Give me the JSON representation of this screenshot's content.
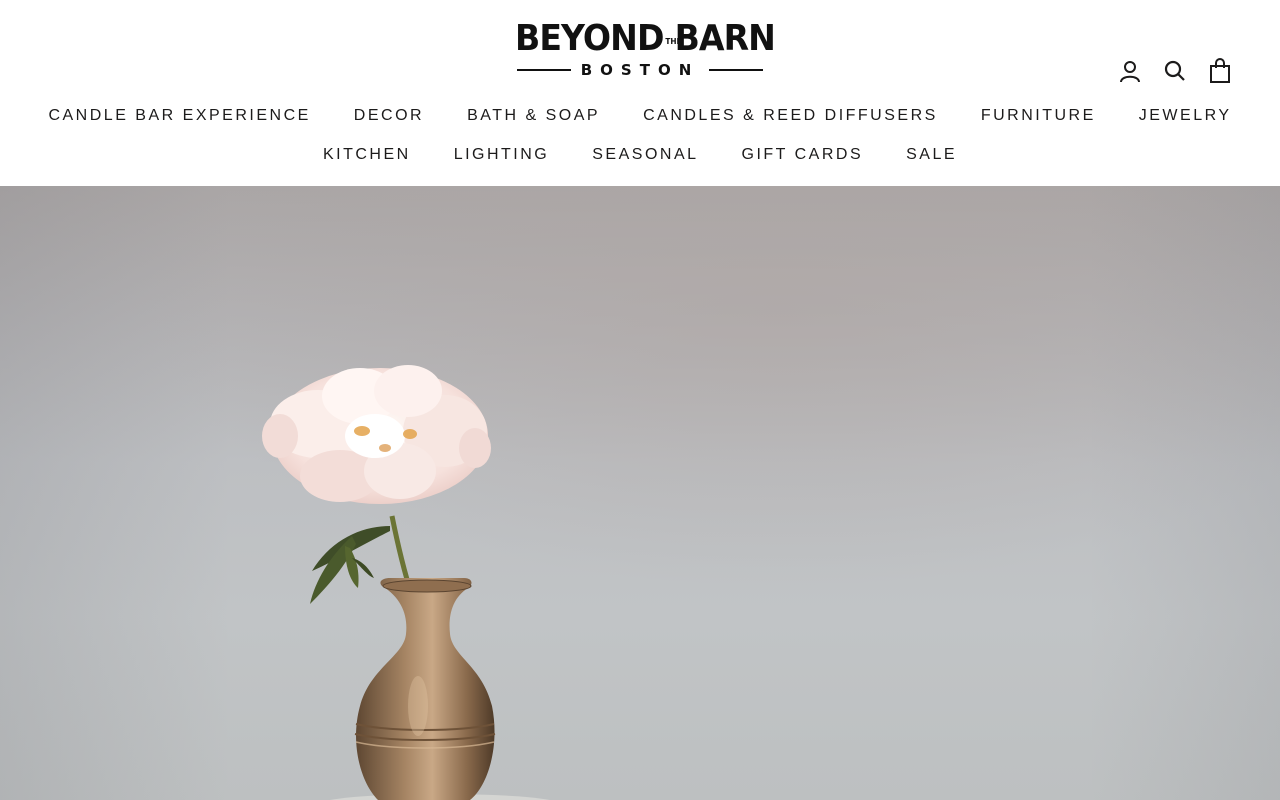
{
  "brand": {
    "name_left": "BEYOND",
    "name_the": "THE",
    "name_right": "BARN",
    "city": "BOSTON"
  },
  "header_icons": [
    {
      "name": "account-icon"
    },
    {
      "name": "search-icon"
    },
    {
      "name": "cart-bag-icon"
    }
  ],
  "nav": {
    "row1": [
      "CANDLE BAR EXPERIENCE",
      "DECOR",
      "BATH & SOAP",
      "CANDLES & REED DIFFUSERS",
      "FURNITURE",
      "JEWELRY"
    ],
    "row2": [
      "KITCHEN",
      "LIGHTING",
      "SEASONAL",
      "GIFT CARDS",
      "SALE"
    ]
  },
  "hero": {
    "image": "peony-in-brass-vase",
    "colors": {
      "background": "#bcbec1",
      "petal": "#f6e4e0",
      "brass": "#9a7451",
      "stem": "#6f7a3a"
    }
  }
}
